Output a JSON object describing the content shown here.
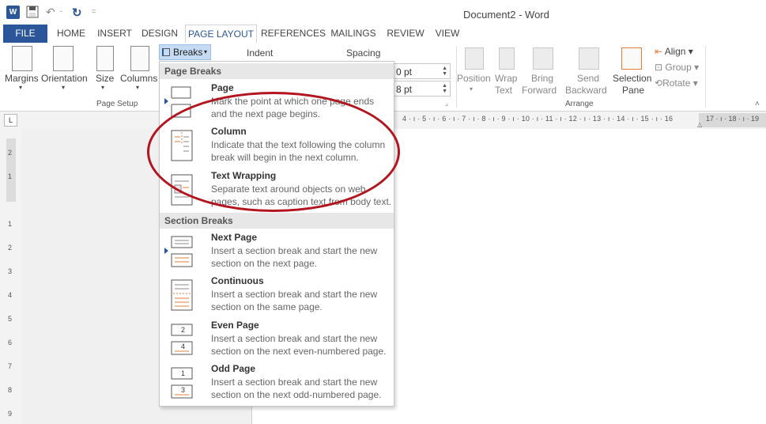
{
  "window": {
    "title": "Document2 - Word"
  },
  "quick_access": {
    "undo_sep": "-",
    "customize": "="
  },
  "tabs": [
    "FILE",
    "HOME",
    "INSERT",
    "DESIGN",
    "PAGE LAYOUT",
    "REFERENCES",
    "MAILINGS",
    "REVIEW",
    "VIEW"
  ],
  "active_tab": "PAGE LAYOUT",
  "ribbon": {
    "page_setup": {
      "margins": "Margins",
      "orientation": "Orientation",
      "size": "Size",
      "columns": "Columns",
      "breaks": "Breaks",
      "group_label": "Page Setup"
    },
    "paragraph": {
      "indent": "Indent",
      "spacing": "Spacing",
      "before_value": "0 pt",
      "after_value": "8 pt"
    },
    "arrange": {
      "position": "Position",
      "wrap_text_1": "Wrap",
      "wrap_text_2": "Text",
      "bring_forward_1": "Bring",
      "bring_forward_2": "Forward",
      "send_backward_1": "Send",
      "send_backward_2": "Backward",
      "selection_pane_1": "Selection",
      "selection_pane_2": "Pane",
      "align": "Align",
      "group": "Group",
      "rotate": "Rotate",
      "group_label": "Arrange"
    }
  },
  "ruler": {
    "corner": "L",
    "horizontal_ticks": "4 · ı · 5 · ı · 6 · ı · 7 · ı · 8 · ı · 9 · ı · 10 · ı · 11 · ı · 12 · ı · 13 · ı · 14 · ı · 15 · ı · 16",
    "horizontal_end": "17 · ı · 18 · ı · 19",
    "vertical_ticks": [
      "2",
      "1",
      "1",
      "2",
      "3",
      "4",
      "5",
      "6",
      "7",
      "8",
      "9"
    ]
  },
  "breaks_menu": {
    "page_breaks_header": "Page Breaks",
    "section_breaks_header": "Section Breaks",
    "items": [
      {
        "title": "Page",
        "desc1": "Mark the point at which one page ends",
        "desc2": "and the next page begins."
      },
      {
        "title": "Column",
        "desc1": "Indicate that the text following the column",
        "desc2": "break will begin in the next column."
      },
      {
        "title": "Text Wrapping",
        "desc1": "Separate text around objects on web",
        "desc2": "pages, such as caption text from body text."
      },
      {
        "title": "Next Page",
        "desc1": "Insert a section break and start the new",
        "desc2": "section on the next page."
      },
      {
        "title": "Continuous",
        "desc1": "Insert a section break and start the new",
        "desc2": "section on the same page."
      },
      {
        "title": "Even Page",
        "desc1": "Insert a section break and start the new",
        "desc2": "section on the next even-numbered page.",
        "num_top": "2",
        "num_bottom": "4"
      },
      {
        "title": "Odd Page",
        "desc1": "Insert a section break and start the new",
        "desc2": "section on the next odd-numbered page.",
        "num_top": "1",
        "num_bottom": "3"
      }
    ]
  },
  "colors": {
    "word_blue": "#2b579a",
    "annotation_red": "#b3151f",
    "accent_orange": "#e57c3a"
  }
}
